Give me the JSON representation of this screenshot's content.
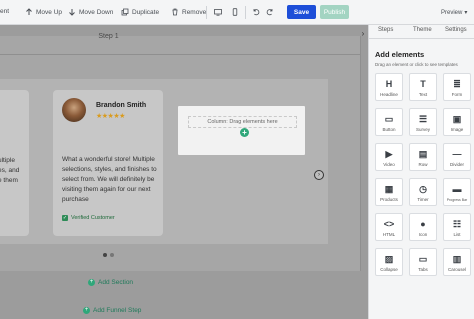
{
  "toolbar": {
    "back_label": "ent",
    "move_up": "Move Up",
    "move_down": "Move Down",
    "duplicate": "Duplicate",
    "remove": "Remove",
    "save": "Save",
    "publish": "Publish",
    "preview": "Preview"
  },
  "canvas": {
    "step_title": "Step 1",
    "left_card_text": "ultiple\nes, and\ne them",
    "testimonial": {
      "name": "Brandon Smith",
      "stars": "★★★★★",
      "review": "What a wonderful store! Multiple selections, styles, and finishes to select from. We will definitely be visiting them again for our next purchase",
      "verified": "Verified Customer"
    },
    "empty_column": "Column: Drag elements here",
    "add_section": "Add Section",
    "add_funnel_step": "Add Funnel Step"
  },
  "panel": {
    "tabs": [
      "Steps",
      "Theme",
      "Settings"
    ],
    "title": "Add elements",
    "subtitle": "Drag an element or click to see templates",
    "elements": [
      {
        "label": "Headline",
        "icon": "H"
      },
      {
        "label": "Text",
        "icon": "T"
      },
      {
        "label": "Form",
        "icon": "≣"
      },
      {
        "label": "Button",
        "icon": "▭"
      },
      {
        "label": "Survey",
        "icon": "☰"
      },
      {
        "label": "Image",
        "icon": "▣"
      },
      {
        "label": "Video",
        "icon": "▶"
      },
      {
        "label": "Row",
        "icon": "▤"
      },
      {
        "label": "Divider",
        "icon": "—"
      },
      {
        "label": "Products",
        "icon": "▦"
      },
      {
        "label": "Timer",
        "icon": "◷"
      },
      {
        "label": "Progress Bar",
        "icon": "▬"
      },
      {
        "label": "HTML",
        "icon": "<>"
      },
      {
        "label": "Icon",
        "icon": "●"
      },
      {
        "label": "List",
        "icon": "☷"
      },
      {
        "label": "Collapse",
        "icon": "▨"
      },
      {
        "label": "Tabs",
        "icon": "▭"
      },
      {
        "label": "Carousel",
        "icon": "▥"
      }
    ]
  }
}
